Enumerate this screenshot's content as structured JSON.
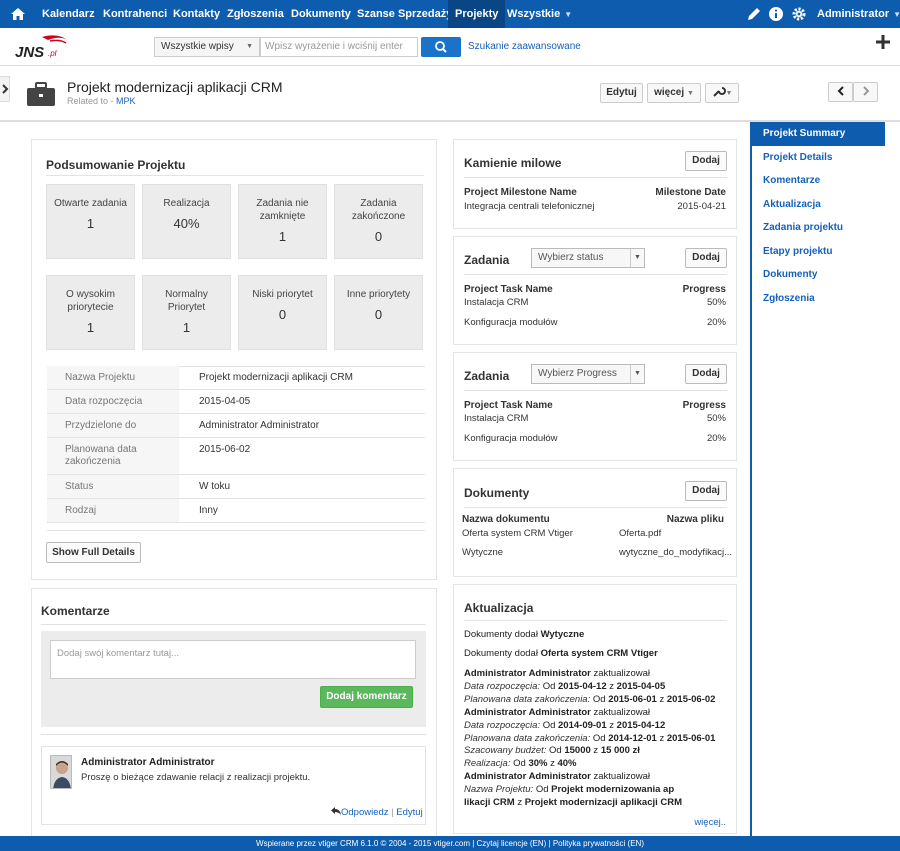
{
  "topnav": {
    "items": [
      "Kalendarz",
      "Kontrahenci",
      "Kontakty",
      "Zgłoszenia",
      "Dokumenty",
      "Szanse Sprzedaży",
      "Projekty",
      "Wszystkie"
    ],
    "active": "Projekty",
    "user": "Administrator",
    "colors": {
      "bar": "#0e5cae",
      "active": "#0a4585"
    }
  },
  "searchbar": {
    "logo_text": "JNS",
    "logo_suffix": ".pl",
    "scope_value": "Wszystkie wpisy",
    "search_placeholder": "Wpisz wyrażenie i wciśnij enter",
    "advanced_label": "Szukanie zaawansowane"
  },
  "header": {
    "title": "Projekt modernizacji aplikacji CRM",
    "related_prefix": "Related to - ",
    "related_link": "MPK",
    "edit_label": "Edytuj",
    "more_label": "więcej"
  },
  "summary": {
    "title": "Podsumowanie Projektu",
    "tiles": [
      {
        "label": "Otwarte zadania",
        "value": "1"
      },
      {
        "label": "Realizacja",
        "value": "40%"
      },
      {
        "label": "Zadania nie zamknięte",
        "value": "1"
      },
      {
        "label": "Zadania zakończone",
        "value": "0"
      },
      {
        "label": "O wysokim priorytecie",
        "value": "1"
      },
      {
        "label": "Normalny Priorytet",
        "value": "1"
      },
      {
        "label": "Niski priorytet",
        "value": "0"
      },
      {
        "label": "Inne priorytety",
        "value": "0"
      }
    ],
    "details": [
      {
        "label": "Nazwa Projektu",
        "value": "Projekt modernizacji aplikacji CRM"
      },
      {
        "label": "Data rozpoczęcia",
        "value": "2015-04-05"
      },
      {
        "label": "Przydzielone do",
        "value": "Administrator Administrator"
      },
      {
        "label": "Planowana data zakończenia",
        "value": "2015-06-02"
      },
      {
        "label": "Status",
        "value": "W toku"
      },
      {
        "label": "Rodzaj",
        "value": "Inny"
      }
    ],
    "show_full_label": "Show Full Details"
  },
  "comments": {
    "title": "Komentarze",
    "placeholder": "Dodaj swój komentarz tutaj...",
    "add_label": "Dodaj komentarz",
    "items": [
      {
        "author": "Administrator Administrator",
        "text": "Proszę o bieżące zdawanie relacji z realizacji projektu.",
        "reply": "Odpowiedz",
        "sep": "|",
        "edit": "Edytuj"
      }
    ]
  },
  "milestones": {
    "title": "Kamienie milowe",
    "add_label": "Dodaj",
    "col1": "Project Milestone Name",
    "col2": "Milestone Date",
    "rows": [
      {
        "name": "Integracja centrali telefonicznej",
        "date": "2015-04-21"
      }
    ]
  },
  "tasks_status": {
    "title": "Zadania",
    "filter": "Wybierz status",
    "add_label": "Dodaj",
    "col1": "Project Task Name",
    "col2": "Progress",
    "rows": [
      {
        "name": "Instalacja CRM",
        "progress": "50%"
      },
      {
        "name": "Konfiguracja modułów",
        "progress": "20%"
      }
    ]
  },
  "tasks_progress": {
    "title": "Zadania",
    "filter": "Wybierz Progress",
    "add_label": "Dodaj",
    "col1": "Project Task Name",
    "col2": "Progress",
    "rows": [
      {
        "name": "Instalacja CRM",
        "progress": "50%"
      },
      {
        "name": "Konfiguracja modułów",
        "progress": "20%"
      }
    ]
  },
  "documents": {
    "title": "Dokumenty",
    "add_label": "Dodaj",
    "col1": "Nazwa dokumentu",
    "col2": "Nazwa pliku",
    "rows": [
      {
        "name": "Oferta system CRM Vtiger",
        "file": "Oferta.pdf"
      },
      {
        "name": "Wytyczne",
        "file": "wytyczne_do_modyfikacj..."
      }
    ]
  },
  "updates": {
    "title": "Aktualizacja",
    "doc1_prefix": "Dokumenty dodał ",
    "doc1_name": "Wytyczne",
    "doc2_prefix": "Dokumenty dodał ",
    "doc2_name": "Oferta system CRM Vtiger",
    "u1_user": "Administrator Administrator",
    "u1_action": " zaktualizował",
    "u1_f1": "Data rozpoczęcia",
    "u1_f1_from": "2015-04-12",
    "u1_f1_to": "2015-04-05",
    "u1_f2": "Planowana data zakończenia",
    "u1_f2_from": "2015-06-01",
    "u1_f2_to": "2015-06-02",
    "u2_user": "Administrator Administrator",
    "u2_action": " zaktualizował",
    "u2_f1": "Data rozpoczęcia",
    "u2_f1_from": "2014-09-01",
    "u2_f1_to": "2015-04-12",
    "u2_f2": "Planowana data zakończenia",
    "u2_f2_from": "2014-12-01",
    "u2_f2_to": "2015-06-01",
    "u2_f3": "Szacowany budżet",
    "u2_f3_from": "15000",
    "u2_f3_to": "15 000 zł",
    "u2_f4": "Realizacja",
    "u2_f4_from": "30%",
    "u2_f4_to": "40%",
    "u3_user": "Administrator Administrator",
    "u3_action": " zaktualizował",
    "u3_f1": "Nazwa Projektu",
    "u3_f1_from_a": "Projekt modernizowania ap",
    "u3_f1_from_b": "likacji CRM",
    "u3_f1_to": "Projekt modernizacji aplikacji CRM",
    "word_from": "Od",
    "word_to": "z",
    "more": "więcej.."
  },
  "rightnav": {
    "items": [
      "Projekt Summary",
      "Projekt Details",
      "Komentarze",
      "Aktualizacja",
      "Zadania projektu",
      "Etapy projektu",
      "Dokumenty",
      "Zgłoszenia"
    ],
    "active": "Projekt Summary"
  },
  "footer": {
    "text": "Wspierane przez vtiger CRM 6.1.0  © 2004 - 2015  vtiger.com | Czytaj licencje (EN) | Polityka prywatności (EN)"
  }
}
